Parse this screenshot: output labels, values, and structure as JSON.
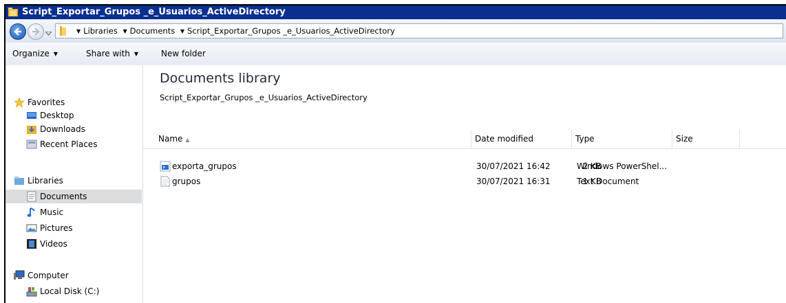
{
  "window": {
    "title": "Script_Exportar_Grupos _e_Usuarios_ActiveDirectory"
  },
  "address": {
    "crumbs": [
      "Libraries",
      "Documents",
      "Script_Exportar_Grupos _e_Usuarios_ActiveDirectory"
    ]
  },
  "toolbar": {
    "organize": "Organize",
    "share_with": "Share with",
    "new_folder": "New folder"
  },
  "nav": {
    "favorites": "Favorites",
    "desktop": "Desktop",
    "downloads": "Downloads",
    "recent": "Recent Places",
    "libraries": "Libraries",
    "documents": "Documents",
    "music": "Music",
    "pictures": "Pictures",
    "videos": "Videos",
    "computer": "Computer",
    "local_disk": "Local Disk (C:)"
  },
  "content": {
    "title": "Documents library",
    "subtitle": "Script_Exportar_Grupos _e_Usuarios_ActiveDirectory",
    "columns": {
      "name": "Name",
      "date": "Date modified",
      "type": "Type",
      "size": "Size"
    },
    "files": [
      {
        "name": "exporta_grupos",
        "date": "30/07/2021 16:42",
        "type": "Windows PowerShel...",
        "size": "2 KB",
        "icon": "powershell-script-icon"
      },
      {
        "name": "grupos",
        "date": "30/07/2021 16:31",
        "type": "Text Document",
        "size": "1 KB",
        "icon": "text-document-icon"
      }
    ]
  },
  "colors": {
    "titlebar": "#0a2f8f",
    "selected_nav": "#dbdcdd"
  }
}
